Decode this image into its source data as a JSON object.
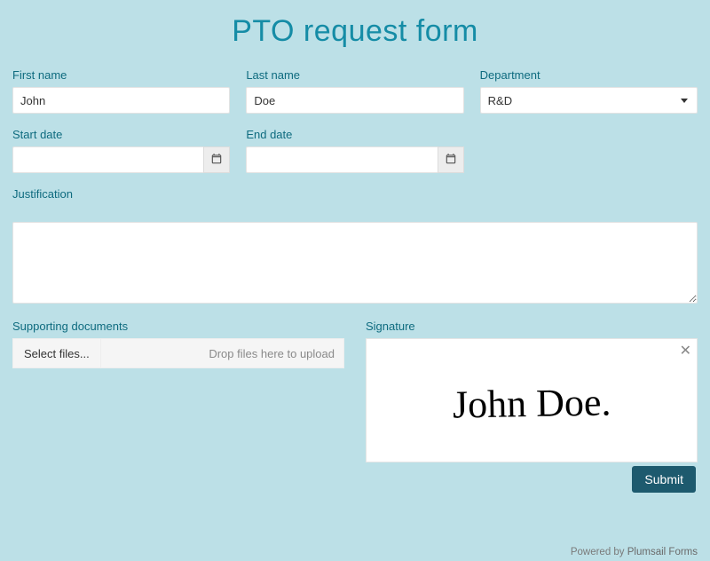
{
  "title": "PTO request form",
  "fields": {
    "first_name": {
      "label": "First name",
      "value": "John"
    },
    "last_name": {
      "label": "Last name",
      "value": "Doe"
    },
    "department": {
      "label": "Department",
      "selected": "R&D"
    },
    "start_date": {
      "label": "Start date",
      "value": ""
    },
    "end_date": {
      "label": "End date",
      "value": ""
    },
    "justification": {
      "label": "Justification",
      "value": ""
    },
    "documents": {
      "label": "Supporting documents",
      "button": "Select files...",
      "hint": "Drop files here to upload"
    },
    "signature": {
      "label": "Signature",
      "value": "John Doe."
    }
  },
  "submit_label": "Submit",
  "footer": {
    "prefix": "Powered by ",
    "link": "Plumsail Forms"
  }
}
